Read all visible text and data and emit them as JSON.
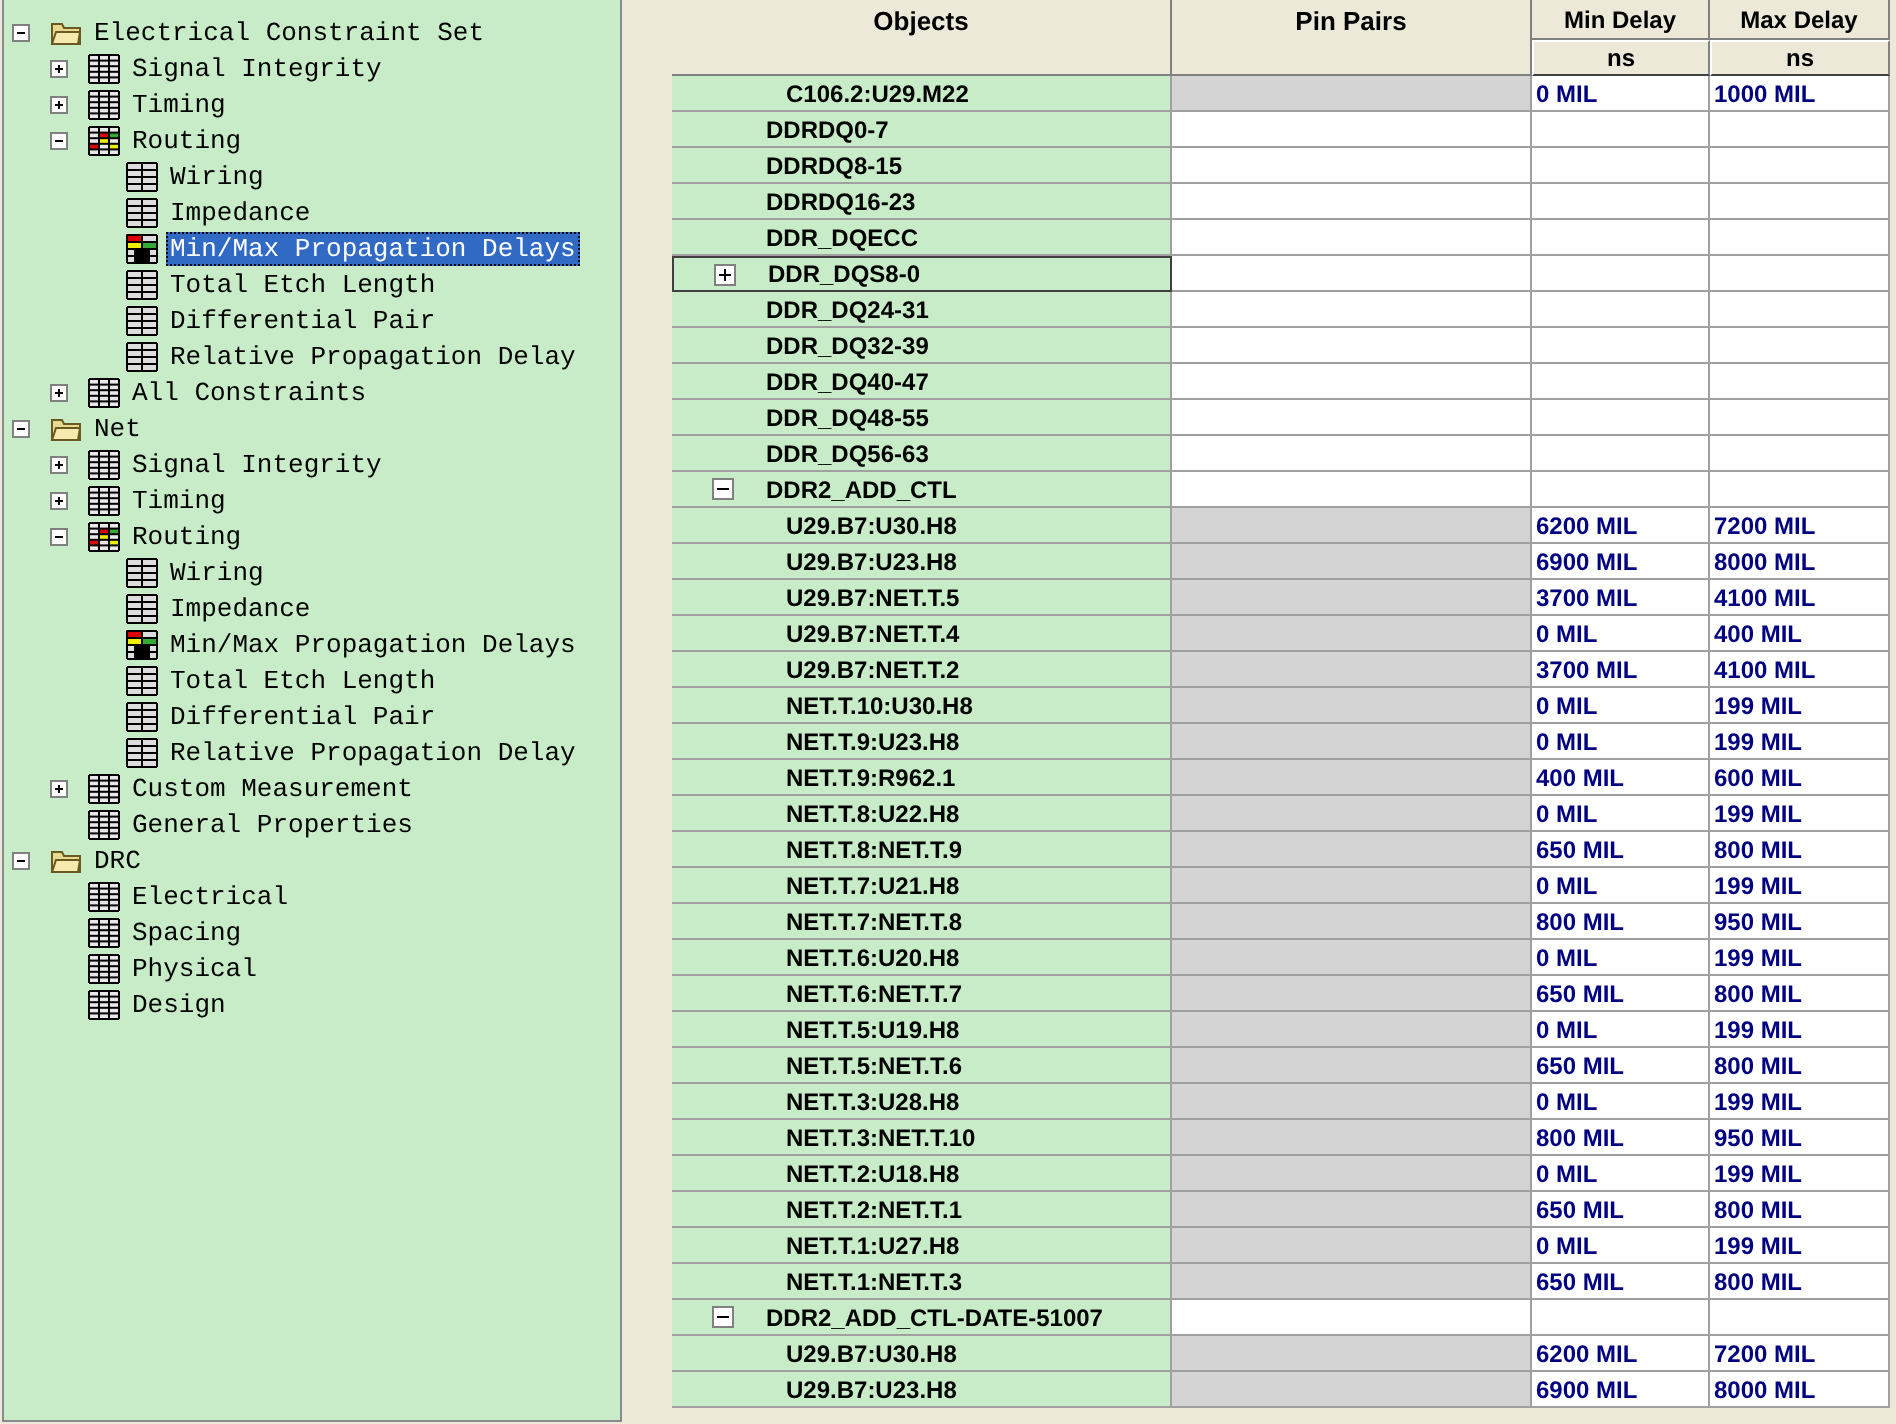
{
  "tree": [
    {
      "label": "Electrical Constraint Set",
      "kind": "folder",
      "expanded": true,
      "selected": false,
      "children": [
        {
          "label": "Signal Integrity",
          "kind": "table",
          "expanded": false,
          "selected": false
        },
        {
          "label": "Timing",
          "kind": "table",
          "expanded": false,
          "selected": false
        },
        {
          "label": "Routing",
          "kind": "colored_table",
          "expanded": true,
          "selected": false,
          "children": [
            {
              "label": "Wiring",
              "kind": "sheet",
              "selected": false
            },
            {
              "label": "Impedance",
              "kind": "sheet",
              "selected": false
            },
            {
              "label": "Min/Max Propagation Delays",
              "kind": "colored_sheet",
              "selected": true
            },
            {
              "label": "Total Etch Length",
              "kind": "sheet",
              "selected": false
            },
            {
              "label": "Differential Pair",
              "kind": "sheet",
              "selected": false
            },
            {
              "label": "Relative Propagation Delay",
              "kind": "sheet",
              "selected": false
            }
          ]
        },
        {
          "label": "All Constraints",
          "kind": "table",
          "expanded": false,
          "selected": false
        }
      ]
    },
    {
      "label": "Net",
      "kind": "folder",
      "expanded": true,
      "selected": false,
      "children": [
        {
          "label": "Signal Integrity",
          "kind": "table",
          "expanded": false,
          "selected": false
        },
        {
          "label": "Timing",
          "kind": "table",
          "expanded": false,
          "selected": false
        },
        {
          "label": "Routing",
          "kind": "colored_table",
          "expanded": true,
          "selected": false,
          "children": [
            {
              "label": "Wiring",
              "kind": "sheet",
              "selected": false
            },
            {
              "label": "Impedance",
              "kind": "sheet",
              "selected": false
            },
            {
              "label": "Min/Max Propagation Delays",
              "kind": "colored_sheet",
              "selected": false
            },
            {
              "label": "Total Etch Length",
              "kind": "sheet",
              "selected": false
            },
            {
              "label": "Differential Pair",
              "kind": "sheet",
              "selected": false
            },
            {
              "label": "Relative Propagation Delay",
              "kind": "sheet",
              "selected": false
            }
          ]
        },
        {
          "label": "Custom Measurement",
          "kind": "table",
          "expanded": false,
          "selected": false
        },
        {
          "label": "General Properties",
          "kind": "table",
          "selected": false
        }
      ]
    },
    {
      "label": "DRC",
      "kind": "folder",
      "expanded": true,
      "selected": false,
      "children": [
        {
          "label": "Electrical",
          "kind": "table",
          "selected": false
        },
        {
          "label": "Spacing",
          "kind": "table",
          "selected": false
        },
        {
          "label": "Physical",
          "kind": "table",
          "selected": false
        },
        {
          "label": "Design",
          "kind": "table",
          "selected": false
        }
      ]
    }
  ],
  "table": {
    "columns": [
      {
        "label": "Objects"
      },
      {
        "label": "Pin Pairs"
      },
      {
        "label": "Min Delay",
        "unit": "ns"
      },
      {
        "label": "Max Delay",
        "unit": "ns"
      }
    ],
    "rows": [
      {
        "object": "C106.2:U29.M22",
        "kind": "pin_pair",
        "min": "0 MIL",
        "max": "1000 MIL"
      },
      {
        "object": "DDRDQ0-7",
        "kind": "net",
        "focused": false
      },
      {
        "object": "DDRDQ8-15",
        "kind": "net",
        "focused": false
      },
      {
        "object": "DDRDQ16-23",
        "kind": "net",
        "focused": false
      },
      {
        "object": "DDR_DQECC",
        "kind": "net",
        "focused": false
      },
      {
        "object": "DDR_DQS8-0",
        "kind": "net",
        "expanded": false,
        "focused": true
      },
      {
        "object": "DDR_DQ24-31",
        "kind": "net",
        "focused": false
      },
      {
        "object": "DDR_DQ32-39",
        "kind": "net",
        "focused": false
      },
      {
        "object": "DDR_DQ40-47",
        "kind": "net",
        "focused": false
      },
      {
        "object": "DDR_DQ48-55",
        "kind": "net",
        "focused": false
      },
      {
        "object": "DDR_DQ56-63",
        "kind": "net",
        "focused": false
      },
      {
        "object": "DDR2_ADD_CTL",
        "kind": "net",
        "expanded": true,
        "focused": false
      },
      {
        "object": "U29.B7:U30.H8",
        "kind": "pin_pair",
        "min": "6200 MIL",
        "max": "7200 MIL"
      },
      {
        "object": "U29.B7:U23.H8",
        "kind": "pin_pair",
        "min": "6900 MIL",
        "max": "8000 MIL"
      },
      {
        "object": "U29.B7:NET.T.5",
        "kind": "pin_pair",
        "min": "3700 MIL",
        "max": "4100 MIL"
      },
      {
        "object": "U29.B7:NET.T.4",
        "kind": "pin_pair",
        "min": "0 MIL",
        "max": "400 MIL"
      },
      {
        "object": "U29.B7:NET.T.2",
        "kind": "pin_pair",
        "min": "3700 MIL",
        "max": "4100 MIL"
      },
      {
        "object": "NET.T.10:U30.H8",
        "kind": "pin_pair",
        "min": "0 MIL",
        "max": "199 MIL"
      },
      {
        "object": "NET.T.9:U23.H8",
        "kind": "pin_pair",
        "min": "0 MIL",
        "max": "199 MIL"
      },
      {
        "object": "NET.T.9:R962.1",
        "kind": "pin_pair",
        "min": "400 MIL",
        "max": "600 MIL"
      },
      {
        "object": "NET.T.8:U22.H8",
        "kind": "pin_pair",
        "min": "0 MIL",
        "max": "199 MIL"
      },
      {
        "object": "NET.T.8:NET.T.9",
        "kind": "pin_pair",
        "min": "650 MIL",
        "max": "800 MIL"
      },
      {
        "object": "NET.T.7:U21.H8",
        "kind": "pin_pair",
        "min": "0 MIL",
        "max": "199 MIL"
      },
      {
        "object": "NET.T.7:NET.T.8",
        "kind": "pin_pair",
        "min": "800 MIL",
        "max": "950 MIL"
      },
      {
        "object": "NET.T.6:U20.H8",
        "kind": "pin_pair",
        "min": "0 MIL",
        "max": "199 MIL"
      },
      {
        "object": "NET.T.6:NET.T.7",
        "kind": "pin_pair",
        "min": "650 MIL",
        "max": "800 MIL"
      },
      {
        "object": "NET.T.5:U19.H8",
        "kind": "pin_pair",
        "min": "0 MIL",
        "max": "199 MIL"
      },
      {
        "object": "NET.T.5:NET.T.6",
        "kind": "pin_pair",
        "min": "650 MIL",
        "max": "800 MIL"
      },
      {
        "object": "NET.T.3:U28.H8",
        "kind": "pin_pair",
        "min": "0 MIL",
        "max": "199 MIL"
      },
      {
        "object": "NET.T.3:NET.T.10",
        "kind": "pin_pair",
        "min": "800 MIL",
        "max": "950 MIL"
      },
      {
        "object": "NET.T.2:U18.H8",
        "kind": "pin_pair",
        "min": "0 MIL",
        "max": "199 MIL"
      },
      {
        "object": "NET.T.2:NET.T.1",
        "kind": "pin_pair",
        "min": "650 MIL",
        "max": "800 MIL"
      },
      {
        "object": "NET.T.1:U27.H8",
        "kind": "pin_pair",
        "min": "0 MIL",
        "max": "199 MIL"
      },
      {
        "object": "NET.T.1:NET.T.3",
        "kind": "pin_pair",
        "min": "650 MIL",
        "max": "800 MIL"
      },
      {
        "object": "DDR2_ADD_CTL-DATE-51007",
        "kind": "net",
        "expanded": true,
        "focused": false
      },
      {
        "object": "U29.B7:U30.H8",
        "kind": "pin_pair",
        "min": "6200 MIL",
        "max": "7200 MIL"
      },
      {
        "object": "U29.B7:U23.H8",
        "kind": "pin_pair",
        "min": "6900 MIL",
        "max": "8000 MIL"
      }
    ]
  }
}
